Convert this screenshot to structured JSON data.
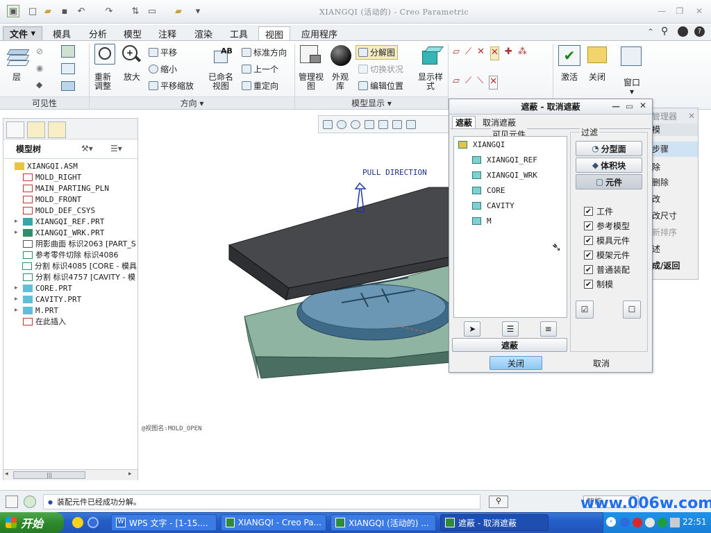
{
  "window": {
    "title": "XIANGQI (活动的) - Creo Parametric"
  },
  "menu_tabs": [
    "文件",
    "模具",
    "分析",
    "模型",
    "注释",
    "渲染",
    "工具",
    "视图",
    "应用程序"
  ],
  "active_tab": "视图",
  "ribbon": {
    "groups": {
      "visibility": "可见性",
      "orientation": "方向",
      "model_display": "模型显示"
    },
    "layers": "层",
    "refit": "重新\n调整",
    "zoom_in": "放大",
    "pan": "平移",
    "zoom_out": "缩小",
    "pan_zoom": "平移缩放",
    "saved_views": "已命名\n视图",
    "standard_orientation": "标准方向",
    "previous": "上一个",
    "reorient": "重定向",
    "manage_views": "管理视\n图",
    "appearance_lib": "外观\n库",
    "exploded_view": "分解图",
    "toggle_status": "切换状况",
    "edit_position": "编辑位置",
    "display_style": "显示样\n式",
    "activate": "激活",
    "close": "关闭",
    "window": "窗口"
  },
  "model_tree": {
    "title": "模型树",
    "items": [
      {
        "label": "XIANGQI.ASM",
        "expand": "",
        "indent": 0,
        "icon": "assembly"
      },
      {
        "label": "MOLD_RIGHT",
        "expand": "",
        "indent": 1,
        "icon": "datum-plane"
      },
      {
        "label": "MAIN_PARTING_PLN",
        "expand": "",
        "indent": 1,
        "icon": "datum-plane"
      },
      {
        "label": "MOLD_FRONT",
        "expand": "",
        "indent": 1,
        "icon": "datum-plane"
      },
      {
        "label": "MOLD_DEF_CSYS",
        "expand": "",
        "indent": 1,
        "icon": "csys"
      },
      {
        "label": "XIANGQI_REF.PRT",
        "expand": "▸",
        "indent": 1,
        "icon": "ref-part"
      },
      {
        "label": "XIANGQI_WRK.PRT",
        "expand": "▸",
        "indent": 1,
        "icon": "work-part"
      },
      {
        "label": "阴影曲面 标识2063 [PART_S",
        "expand": "",
        "indent": 1,
        "icon": "surface"
      },
      {
        "label": "参考零件切除 标识4086",
        "expand": "",
        "indent": 1,
        "icon": "cut"
      },
      {
        "label": "分割 标识4085 [CORE - 模具",
        "expand": "",
        "indent": 1,
        "icon": "split"
      },
      {
        "label": "分割 标识4757 [CAVITY - 模",
        "expand": "",
        "indent": 1,
        "icon": "split"
      },
      {
        "label": "CORE.PRT",
        "expand": "▸",
        "indent": 1,
        "icon": "part"
      },
      {
        "label": "CAVITY.PRT",
        "expand": "▸",
        "indent": 1,
        "icon": "part"
      },
      {
        "label": "M.PRT",
        "expand": "▸",
        "indent": 1,
        "icon": "part"
      },
      {
        "label": "在此插入",
        "expand": "",
        "indent": 1,
        "icon": "insert-here"
      }
    ],
    "scroll_label": "|||"
  },
  "graphics": {
    "pull_direction": "PULL DIRECTION",
    "view_label": "@视图名:MOLD_OPEN"
  },
  "dialog": {
    "title": "遮蔽 - 取消遮蔽",
    "tabs": [
      "遮蔽",
      "取消遮蔽"
    ],
    "visible_components_label": "可见元件",
    "components": [
      {
        "label": "XIANGQI",
        "indent": 0
      },
      {
        "label": "XIANGQI_REF",
        "indent": 1
      },
      {
        "label": "XIANGQI_WRK",
        "indent": 1
      },
      {
        "label": "CORE",
        "indent": 1
      },
      {
        "label": "CAVITY",
        "indent": 1
      },
      {
        "label": "M",
        "indent": 1
      }
    ],
    "filter_label": "过滤",
    "filter_buttons": [
      "分型面",
      "体积块",
      "元件"
    ],
    "checkboxes": [
      {
        "label": "工件",
        "checked": true
      },
      {
        "label": "参考模型",
        "checked": true
      },
      {
        "label": "模具元件",
        "checked": true
      },
      {
        "label": "模架元件",
        "checked": true
      },
      {
        "label": "普通装配",
        "checked": true
      },
      {
        "label": "制模",
        "checked": true
      }
    ],
    "blank_button": "遮蔽",
    "close_button": "关闭",
    "cancel_button": "取消"
  },
  "behind_panel": {
    "title": "管理器",
    "items": [
      "模",
      "步骤",
      "除",
      "删除",
      "改",
      "改尺寸",
      "新排序",
      "述",
      "成/返回"
    ]
  },
  "status": {
    "message": "装配元件已经成功分解。",
    "filter": "智能"
  },
  "taskbar": {
    "start": "开始",
    "tasks": [
      "WPS 文字 - [1-15....",
      "XIANGQI - Creo Pa...",
      "XIANGQI (活动的) ...",
      "遮蔽 - 取消遮蔽"
    ],
    "clock": "22:51"
  },
  "watermark": "www.006w.com"
}
